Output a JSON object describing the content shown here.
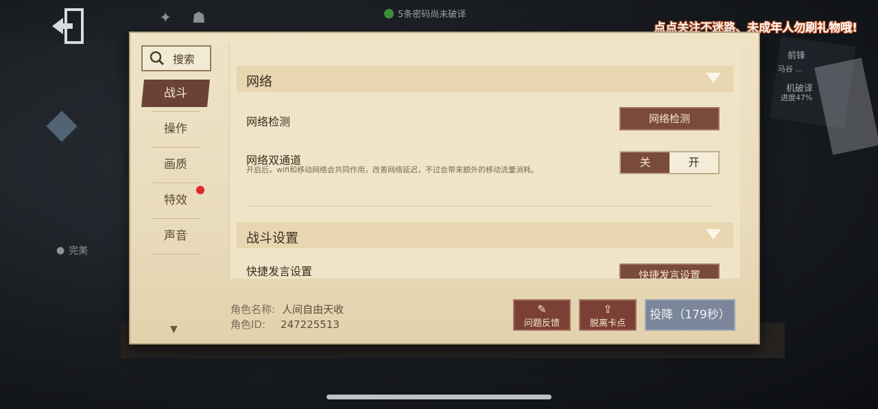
{
  "hud": {
    "top_status": "5条密码尚未破译",
    "banner": "点点关注不迷路、未成年人勿刷礼物哦!",
    "right_label_1": "前锋",
    "right_label_2": "马谷 ...",
    "right_label_3": "机破译",
    "right_label_4": "进度47%",
    "left_player": "完美"
  },
  "sidebar": {
    "search_label": "搜索",
    "items": [
      {
        "label": "战斗",
        "active": true
      },
      {
        "label": "操作"
      },
      {
        "label": "画质"
      },
      {
        "label": "特效",
        "badge": true
      },
      {
        "label": "声音"
      }
    ]
  },
  "content": {
    "network": {
      "title": "网络",
      "detect_label": "网络检测",
      "detect_button": "网络检测",
      "dual_label": "网络双通道",
      "dual_desc": "开启后，wifi和移动网络会共同作用，改善网络延迟，不过会带来额外的移动流量消耗。",
      "toggle_off": "关",
      "toggle_on": "开",
      "toggle_state": "关"
    },
    "battle": {
      "title": "战斗设置",
      "quick_label": "快捷发言设置",
      "quick_button": "快捷发言设置"
    }
  },
  "footer": {
    "role_name_label": "角色名称:",
    "role_name": "人间自由天收",
    "role_id_label": "角色ID:",
    "role_id": "247225513",
    "feedback": "问题反馈",
    "unstuck": "脱离卡点",
    "surrender": "投降（179秒）"
  },
  "colors": {
    "panel": "#efe3c7",
    "accent_brown": "#7a4a3a",
    "surrender_blue": "#7b869a",
    "badge_red": "#d82b2b"
  }
}
